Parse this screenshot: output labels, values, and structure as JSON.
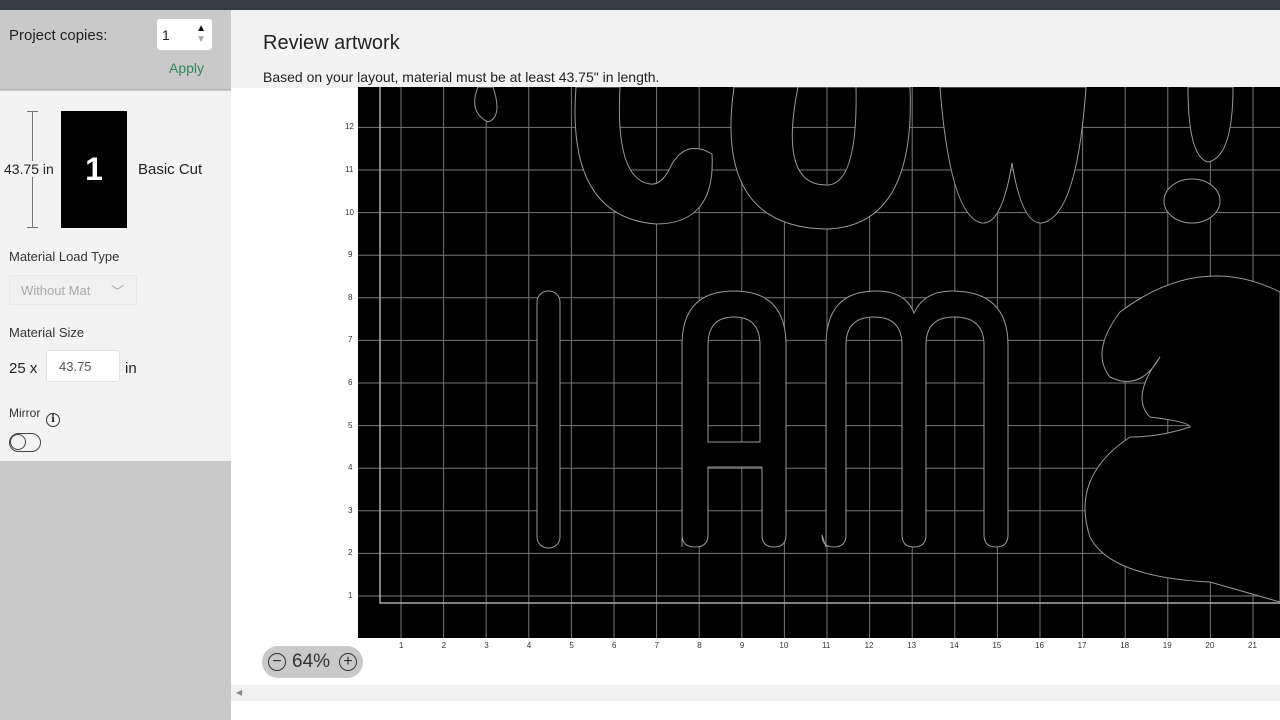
{
  "sidebar": {
    "copies_label": "Project copies:",
    "copies_value": "1",
    "apply_label": "Apply",
    "mat_length": "43.75 in",
    "mat_number": "1",
    "cut_type": "Basic Cut",
    "load_type_label": "Material Load Type",
    "load_type_value": "Without Mat",
    "size_label": "Material Size",
    "size_width": "25 x",
    "size_length": "43.75",
    "size_unit": "in",
    "mirror_label": "Mirror",
    "mirror_on": false
  },
  "main": {
    "title": "Review artwork",
    "subtitle": "Based on your layout, material must be at least 43.75\" in length.",
    "zoom_level": "64%",
    "x_ticks": [
      "1",
      "2",
      "3",
      "4",
      "5",
      "6",
      "7",
      "8",
      "9",
      "10",
      "11",
      "12",
      "13",
      "14",
      "15",
      "16",
      "17",
      "18",
      "19",
      "20",
      "21"
    ],
    "y_ticks": [
      "1",
      "2",
      "3",
      "4",
      "5",
      "6",
      "7",
      "8",
      "9",
      "10",
      "11",
      "12"
    ]
  },
  "colors": {
    "accent": "#2c8a5e",
    "topbar": "#353c44",
    "mat": "#000000"
  }
}
